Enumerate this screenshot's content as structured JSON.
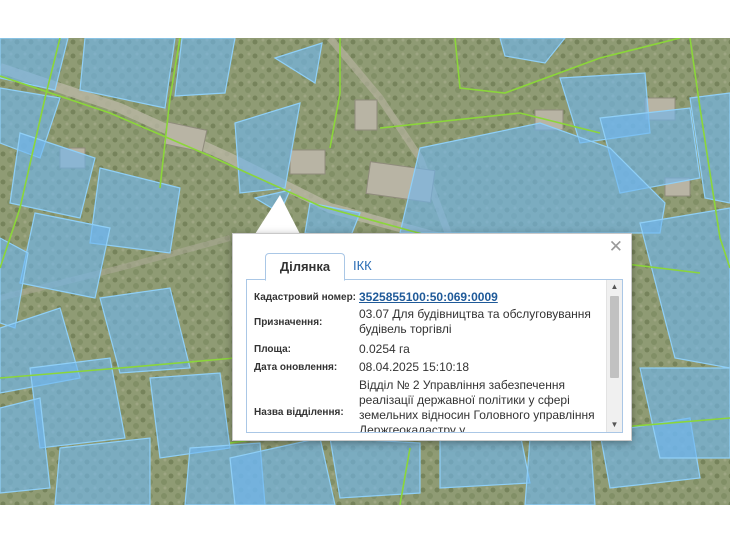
{
  "popup": {
    "close_icon": "close-icon",
    "tabs": [
      {
        "label": "Ділянка",
        "active": true
      },
      {
        "label": "ІКК",
        "active": false
      }
    ],
    "fields": {
      "cadastral_number": {
        "label": "Кадастровий номер:",
        "value": "3525855100:50:069:0009"
      },
      "purpose": {
        "label": "Призначення:",
        "value": "03.07 Для будівництва та обслуговування будівель торгівлі"
      },
      "area": {
        "label": "Площа:",
        "value": "0.0254 га"
      },
      "updated": {
        "label": "Дата оновлення:",
        "value": "08.04.2025 15:10:18"
      },
      "department": {
        "label": "Назва відділення:",
        "value": "Відділ № 2 Управління забезпечення реалізації державної політики у сфері земельних відносин Головного управління Держгеокадастру у"
      }
    }
  },
  "map": {
    "parcel_fill": "#6fb7ef",
    "parcel_stroke": "#7ec5f5",
    "boundary_color": "#8bd63a",
    "imagery_base": "#8d9a72"
  }
}
